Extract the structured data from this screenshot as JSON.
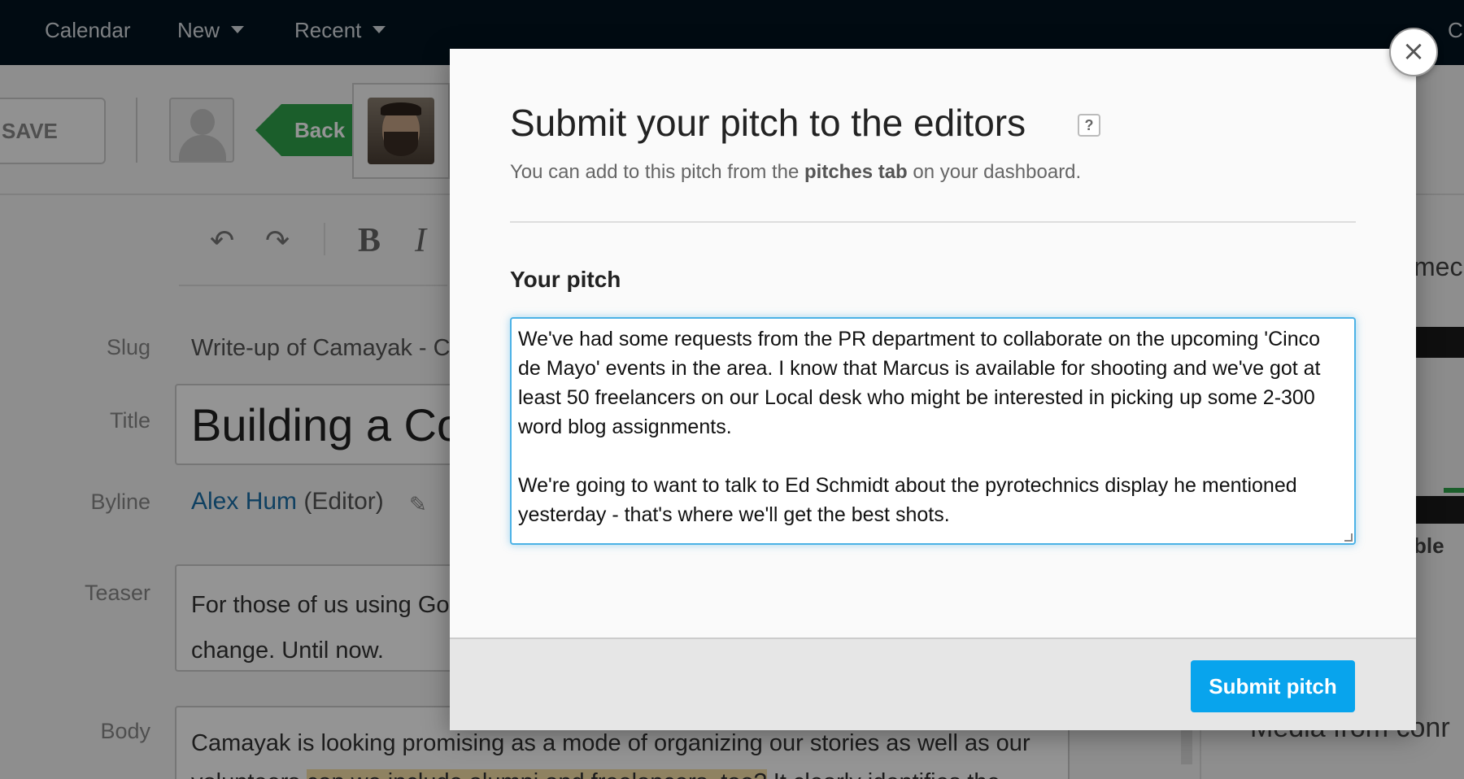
{
  "nav": {
    "calendar": "Calendar",
    "new": "New",
    "recent": "Recent",
    "right_fragment": "C"
  },
  "toolbar": {
    "save": "SAVE",
    "back": "Back"
  },
  "format": {
    "undo_icon": "undo-icon",
    "redo_icon": "redo-icon",
    "bold": "B",
    "italic": "I"
  },
  "fields": {
    "slug_label": "Slug",
    "slug_value": "Write-up of Camayak - C",
    "title_label": "Title",
    "title_value": "Building a Co",
    "byline_label": "Byline",
    "byline_name": "Alex Hum",
    "byline_role": " (Editor)",
    "teaser_label": "Teaser",
    "teaser_line1": "For those of us using Go",
    "teaser_line2": "change. Until now.",
    "body_label": "Body",
    "body_line1": "Camayak is looking promising as a mode of organizing our stories as well as our",
    "body_line2a": "volunteers ",
    "body_line2_highlight": "can we include alumni and freelancers, too?",
    "body_line2b": " It clearly identifies the"
  },
  "right_sidebar": {
    "fragment_top": "mec",
    "fragment_mid": "ble",
    "fragment_bottom": "Media from conr"
  },
  "modal": {
    "title": "Submit your pitch to the editors",
    "help": "?",
    "subtitle_pre": "You can add to this pitch from the ",
    "subtitle_bold": "pitches tab",
    "subtitle_post": " on your dashboard.",
    "pitch_label": "Your pitch",
    "pitch_text": "We've had some requests from the PR department to collaborate on the upcoming 'Cinco de Mayo' events in the area. I know that Marcus is available for shooting and we've got at least 50 freelancers on our Local desk who might be interested in picking up some 2-300 word blog assignments.\n\nWe're going to want to talk to Ed Schmidt about the pyrotechnics display he mentioned yesterday - that's where we'll get the best shots.",
    "submit": "Submit pitch",
    "close": "×"
  },
  "colors": {
    "nav_bg": "#03141f",
    "back_green": "#2fa24a",
    "submit_blue": "#08a4ed",
    "focus_blue": "#4cb2e6",
    "link_blue": "#1a6fa8"
  }
}
